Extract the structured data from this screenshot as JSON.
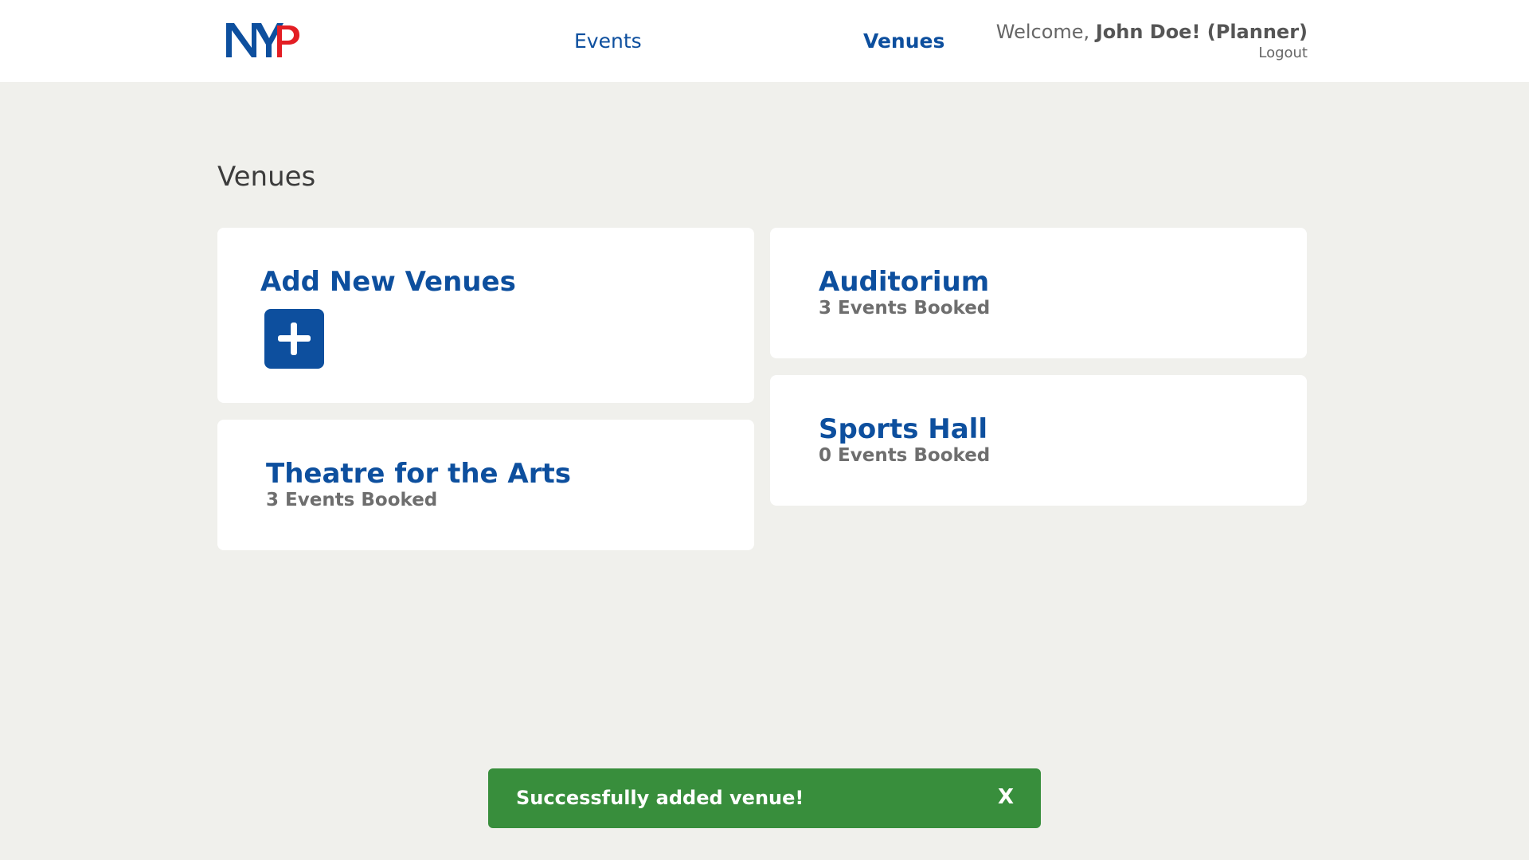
{
  "header": {
    "logo_text": "NYP",
    "nav": {
      "events_label": "Events",
      "venues_label": "Venues"
    },
    "welcome_prefix": "Welcome,",
    "welcome_name": "John Doe! (Planner)",
    "logout_label": "Logout"
  },
  "page": {
    "title": "Venues"
  },
  "add_card": {
    "title": "Add New Venues",
    "icon": "plus-icon"
  },
  "venues": [
    {
      "name": "Theatre for the Arts",
      "booked": "3 Events Booked"
    },
    {
      "name": "Auditorium",
      "booked": "3 Events Booked"
    },
    {
      "name": "Sports Hall",
      "booked": "0 Events Booked"
    }
  ],
  "toast": {
    "message": "Successfully added venue!",
    "close_label": "X",
    "color": "#388e3c"
  },
  "colors": {
    "brand_blue": "#0d4f9e",
    "brand_red": "#e31e24",
    "background": "#f0f0ec"
  }
}
